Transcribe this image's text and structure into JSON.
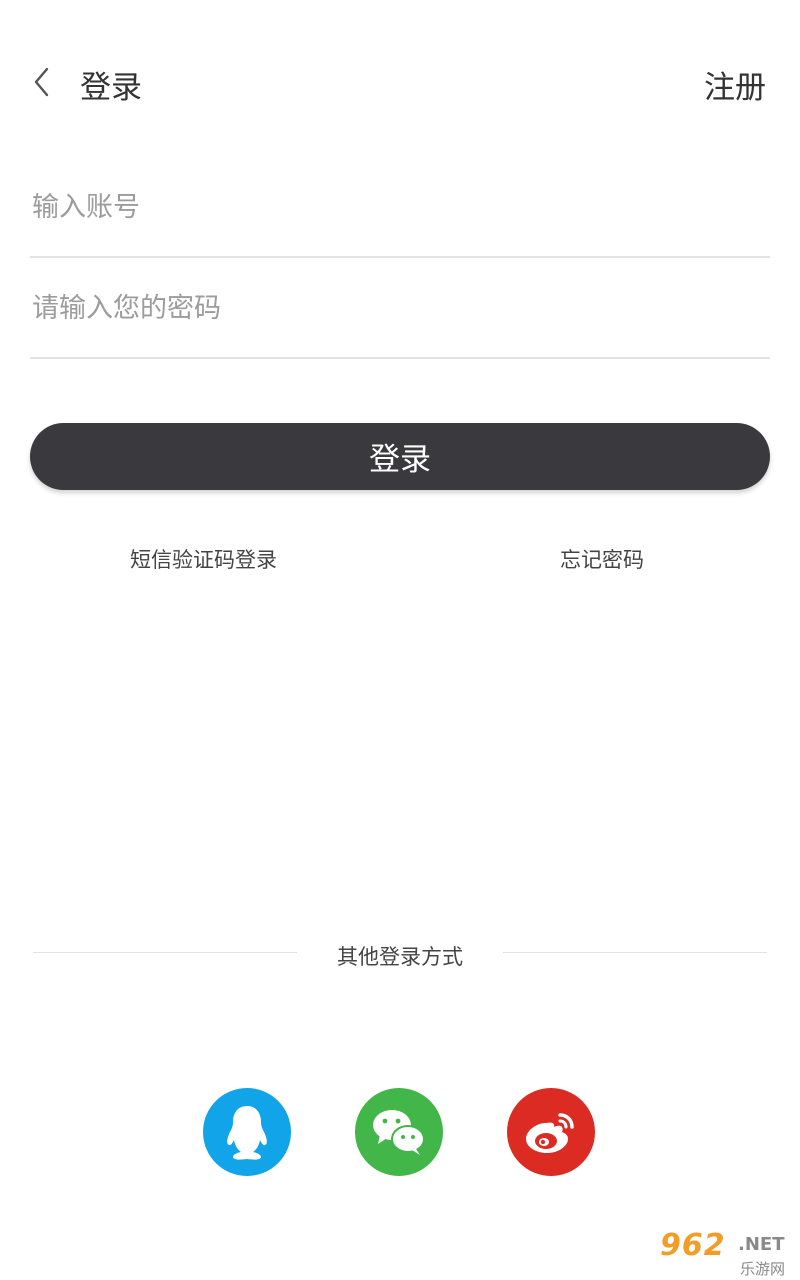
{
  "header": {
    "back_icon": "chevron-left-icon",
    "title": "登录",
    "register_label": "注册"
  },
  "form": {
    "account_placeholder": "输入账号",
    "password_placeholder": "请输入您的密码",
    "login_label": "登录"
  },
  "links": {
    "sms_login": "短信验证码登录",
    "forgot_password": "忘记密码"
  },
  "other_login": {
    "label": "其他登录方式",
    "providers": [
      {
        "name": "qq",
        "icon": "qq-penguin-icon",
        "color": "#11a4e9"
      },
      {
        "name": "wechat",
        "icon": "wechat-icon",
        "color": "#43b649"
      },
      {
        "name": "weibo",
        "icon": "weibo-icon",
        "color": "#dc2b23"
      }
    ]
  },
  "watermark": {
    "brand_number": "962",
    "brand_suffix": ".NET",
    "brand_cn": "乐游网"
  },
  "colors": {
    "button_dark": "#3a393e",
    "divider": "#e3e3e3",
    "placeholder": "#9c9c9c"
  }
}
